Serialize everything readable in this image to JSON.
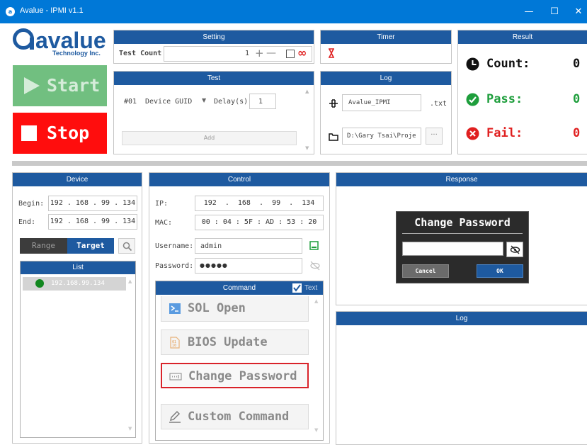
{
  "window": {
    "title": "Avalue - IPMI v1.1",
    "app_icon": "a",
    "minimize": "—",
    "maximize": "☐",
    "close": "✕"
  },
  "logo": {
    "brand": "avalue",
    "sub": "Technology Inc."
  },
  "buttons": {
    "start": "Start",
    "stop": "Stop"
  },
  "setting": {
    "header": "Setting",
    "test_count_label": "Test Count",
    "test_count_value": "1",
    "plus": "+",
    "minus": "—",
    "infinite": "∞"
  },
  "timer": {
    "header": "Timer",
    "icon": "hourglass-icon"
  },
  "result": {
    "header": "Result",
    "count_label": "Count:",
    "count_value": "0",
    "pass_label": "Pass:",
    "pass_value": "0",
    "fail_label": "Fail:",
    "fail_value": "0"
  },
  "test": {
    "header": "Test",
    "index": "#01",
    "command": "Device GUID",
    "delay_label": "Delay(s)",
    "delay_value": "1",
    "add_label": "Add"
  },
  "log_settings": {
    "header": "Log",
    "filename": "Avalue_IPMI",
    "extension": ".txt",
    "path": "D:\\Gary Tsai\\Proje",
    "browse": "···"
  },
  "device": {
    "header": "Device",
    "begin_label": "Begin:",
    "begin_ip": [
      "192",
      "168",
      "99",
      "134"
    ],
    "end_label": "End:",
    "end_ip": [
      "192",
      "168",
      "99",
      "134"
    ],
    "toggle": {
      "range": "Range",
      "target": "Target"
    },
    "list_header": "List",
    "list_items": [
      "192.168.99.134"
    ]
  },
  "control": {
    "header": "Control",
    "ip_label": "IP:",
    "ip": [
      "192",
      "168",
      "99",
      "134"
    ],
    "mac_label": "MAC:",
    "mac": [
      "00",
      "04",
      "5F",
      "AD",
      "53",
      "20"
    ],
    "username_label": "Username:",
    "username": "admin",
    "password_label": "Password:",
    "password": "●●●●●",
    "command_header": "Command",
    "text_checkbox_label": "Text",
    "text_checked": true,
    "commands": [
      "SOL Open",
      "BIOS Update",
      "Change Password",
      "Custom Command"
    ],
    "selected_command": "Change Password"
  },
  "response": {
    "header": "Response",
    "dialog": {
      "title": "Change Password",
      "input_value": "",
      "cancel": "Cancel",
      "ok": "OK"
    }
  },
  "log": {
    "header": "Log"
  },
  "colors": {
    "accent": "#1e5aa0",
    "start": "#71bf80",
    "stop": "#ff0d0d",
    "pass": "#1e9e3c",
    "fail": "#e02020",
    "highlight": "#d9232a"
  }
}
